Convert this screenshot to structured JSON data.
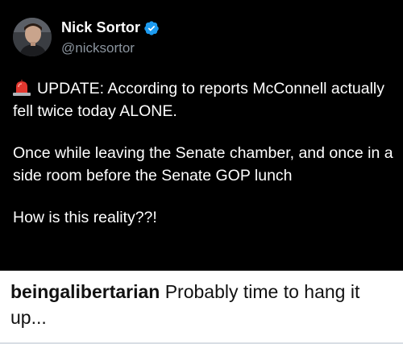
{
  "tweet": {
    "display_name": "Nick Sortor",
    "handle": "@nicksortor",
    "avatar_icon": "person-avatar",
    "verified_icon": "verified-badge-icon",
    "verified_color": "#1d9bf0",
    "siren_icon": "police-siren-emoji",
    "paragraphs": [
      "UPDATE: According to reports McConnell actually fell twice today ALONE.",
      "Once while leaving the Senate chamber, and once in a side room before the Senate GOP lunch",
      "How is this reality??!"
    ]
  },
  "caption": {
    "username": "beingalibertarian",
    "text": "Probably time to hang it up..."
  }
}
